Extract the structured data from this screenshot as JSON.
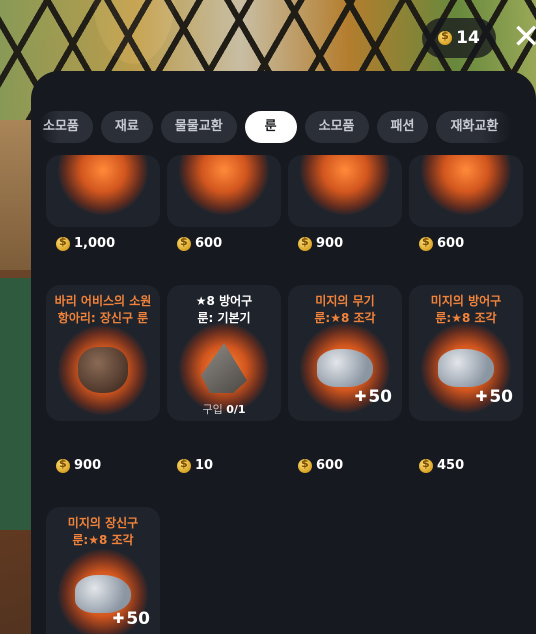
{
  "header": {
    "currency_amount": "14",
    "currency_icon": "coin-icon",
    "close_label": "✕"
  },
  "tabs": [
    {
      "label": "소모품",
      "active": false
    },
    {
      "label": "재료",
      "active": false
    },
    {
      "label": "물물교환",
      "active": false
    },
    {
      "label": "룬",
      "active": true
    },
    {
      "label": "소모품",
      "active": false
    },
    {
      "label": "패션",
      "active": false
    },
    {
      "label": "재화교환",
      "active": false
    }
  ],
  "top_row_prices": [
    "1,000",
    "600",
    "900",
    "600"
  ],
  "items": [
    {
      "title": "바리 어비스의 소원\n항아리: 장신구 룬",
      "title_color": "orange",
      "icon": "jar-icon",
      "price": "900"
    },
    {
      "title": "★8 방어구\n룬: 기본기",
      "title_color": "white",
      "icon": "rune-stone-icon",
      "purchase_label": "구입",
      "purchase_value": "0/1",
      "price": "10"
    },
    {
      "title": "미지의 무기\n룬:★8 조각",
      "title_color": "orange",
      "icon": "rune-fragment-icon",
      "quantity": "50",
      "price": "600"
    },
    {
      "title": "미지의 방어구\n룬:★8 조각",
      "title_color": "orange",
      "icon": "rune-fragment-icon",
      "quantity": "50",
      "price": "450"
    },
    {
      "title": "미지의 장신구\n룬:★8 조각",
      "title_color": "orange",
      "icon": "rune-fragment-icon",
      "quantity": "50"
    }
  ],
  "colors": {
    "accent_orange": "#f0823a",
    "panel_bg": "#16191f",
    "card_bg": "#1f242c"
  }
}
